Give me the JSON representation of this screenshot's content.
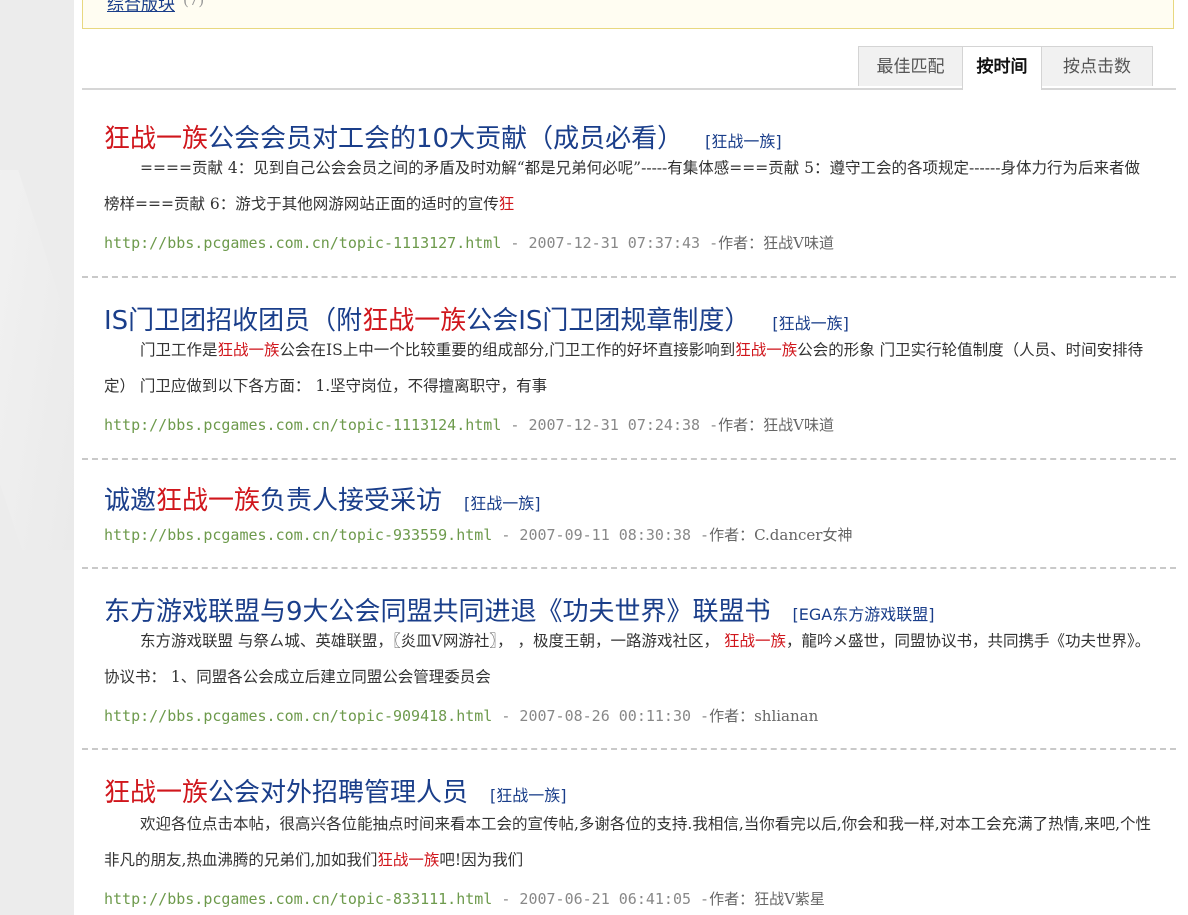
{
  "notice": {
    "link": "综合版块",
    "count": "(7)"
  },
  "sort_tabs": [
    "最佳匹配",
    "按时间",
    "按点击数"
  ],
  "results": [
    {
      "title_parts": [
        {
          "text": "狂战一族",
          "hl": true
        },
        {
          "text": "公会会员对工会的10大贡献（成员必看）",
          "hl": false
        }
      ],
      "tag": "[狂战一族]",
      "snippet_parts": [
        {
          "text": "====贡献 4：见到自己公会会员之间的矛盾及时劝解“都是兄弟何必呢”-----有集体感===贡献 5：遵守工会的各项规定------身体力行为后来者做榜样===贡献 6：游戈于其他网游网站正面的适时的宣传",
          "hl": false
        },
        {
          "text": "狂",
          "hl": true
        }
      ],
      "url": "http://bbs.pcgames.com.cn/topic-1113127.html",
      "date": " - 2007-12-31 07:37:43 -",
      "author_label": "作者：",
      "author": "狂战V味道"
    },
    {
      "title_parts": [
        {
          "text": "IS门卫团招收团员（附",
          "hl": false
        },
        {
          "text": "狂战一族",
          "hl": true
        },
        {
          "text": "公会IS门卫团规章制度）",
          "hl": false
        }
      ],
      "tag": "[狂战一族]",
      "snippet_parts": [
        {
          "text": "门卫工作是",
          "hl": false
        },
        {
          "text": "狂战一族",
          "hl": true
        },
        {
          "text": "公会在IS上中一个比较重要的组成部分,门卫工作的好坏直接影响到",
          "hl": false
        },
        {
          "text": "狂战一族",
          "hl": true
        },
        {
          "text": "公会的形象 门卫实行轮值制度（人员、时间安排待定） 门卫应做到以下各方面： 1.坚守岗位，不得擅离职守，有事",
          "hl": false
        }
      ],
      "url": "http://bbs.pcgames.com.cn/topic-1113124.html",
      "date": " - 2007-12-31 07:24:38 -",
      "author_label": "作者：",
      "author": "狂战V味道"
    },
    {
      "title_parts": [
        {
          "text": "诚邀",
          "hl": false
        },
        {
          "text": "狂战一族",
          "hl": true
        },
        {
          "text": "负责人接受采访",
          "hl": false
        }
      ],
      "tag": "[狂战一族]",
      "snippet_parts": [],
      "url": "http://bbs.pcgames.com.cn/topic-933559.html",
      "date": " - 2007-09-11 08:30:38 -",
      "author_label": "作者：",
      "author": "C.dancer女神"
    },
    {
      "title_parts": [
        {
          "text": "东方游戏联盟与9大公会同盟共同进退《功夫世界》联盟书",
          "hl": false
        }
      ],
      "tag": "[EGA东方游戏联盟]",
      "snippet_parts": [
        {
          "text": "东方游戏联盟 与祭ㄙ城、英雄联盟，〖炎皿V网游社〗， ，极度王朝，一路游戏社区， ",
          "hl": false
        },
        {
          "text": "狂战一族",
          "hl": true
        },
        {
          "text": "，龍吟メ盛世，同盟协议书，共同携手《功夫世界》。 协议书： 1、同盟各公会成立后建立同盟公会管理委员会",
          "hl": false
        }
      ],
      "url": "http://bbs.pcgames.com.cn/topic-909418.html",
      "date": " - 2007-08-26 00:11:30 -",
      "author_label": "作者：",
      "author": "shlianan"
    },
    {
      "title_parts": [
        {
          "text": "狂战一族",
          "hl": true
        },
        {
          "text": "公会对外招聘管理人员",
          "hl": false
        }
      ],
      "tag": "[狂战一族]",
      "snippet_parts": [
        {
          "text": "欢迎各位点击本帖，很高兴各位能抽点时间来看本工会的宣传帖,多谢各位的支持.我相信,当你看完以后,你会和我一样,对本工会充满了热情,来吧,个性非凡的朋友,热血沸腾的兄弟们,加如我们",
          "hl": false
        },
        {
          "text": "狂战一族",
          "hl": true
        },
        {
          "text": "吧!因为我们",
          "hl": false
        }
      ],
      "url": "http://bbs.pcgames.com.cn/topic-833111.html",
      "date": " - 2007-06-21 06:41:05 -",
      "author_label": "作者：",
      "author": "狂战V紫星"
    }
  ]
}
